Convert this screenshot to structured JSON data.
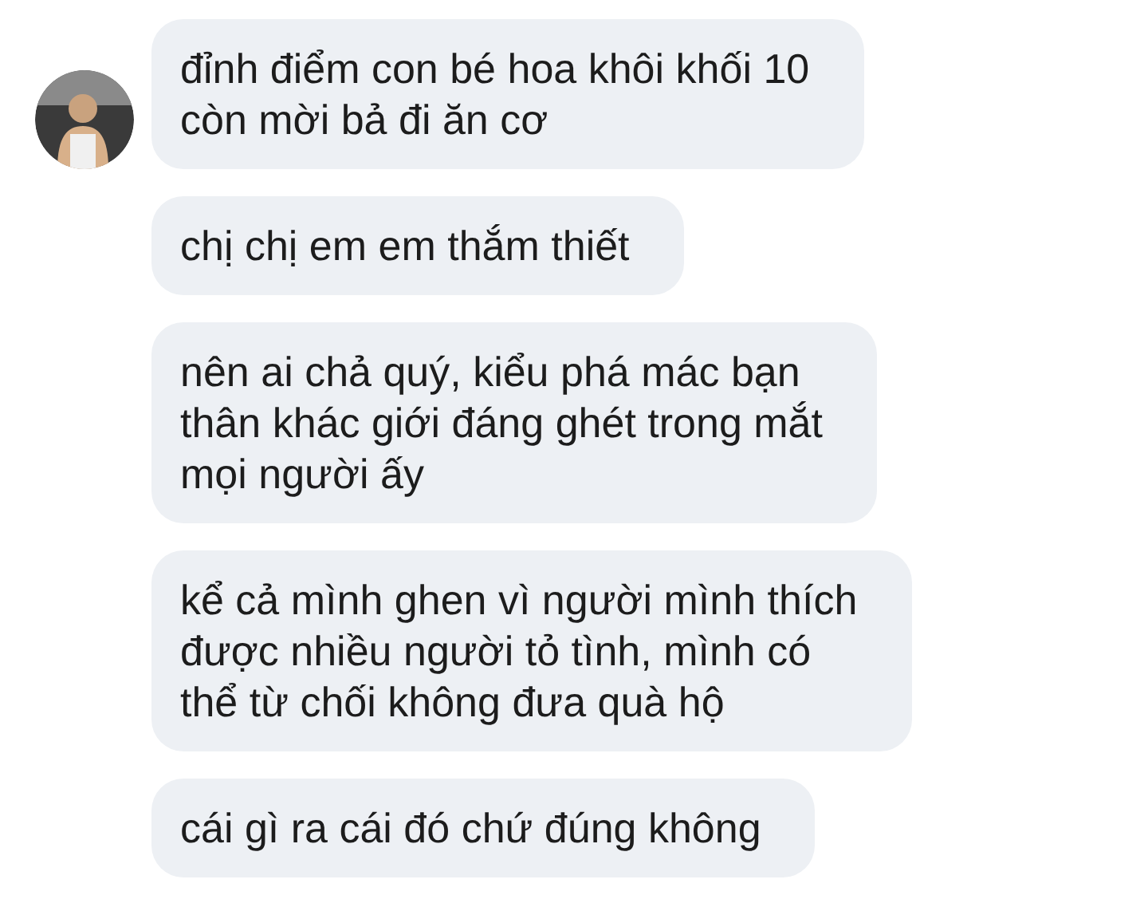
{
  "messages": [
    {
      "text": "đỉnh điểm con bé hoa khôi khối 10\ncòn mời bả đi ăn cơ",
      "avatar": true
    },
    {
      "text": "chị chị em em thắm thiết",
      "avatar": false
    },
    {
      "text": "nên ai chả quý, kiểu phá mác bạn\nthân khác giới đáng ghét trong mắt\nmọi người ấy",
      "avatar": false
    },
    {
      "text": "kể cả mình ghen vì người mình thích\nđược nhiều người tỏ tình, mình có\nthể từ chối không đưa quà hộ",
      "avatar": false
    },
    {
      "text": "cái gì ra cái đó chứ đúng không",
      "avatar": false
    }
  ]
}
